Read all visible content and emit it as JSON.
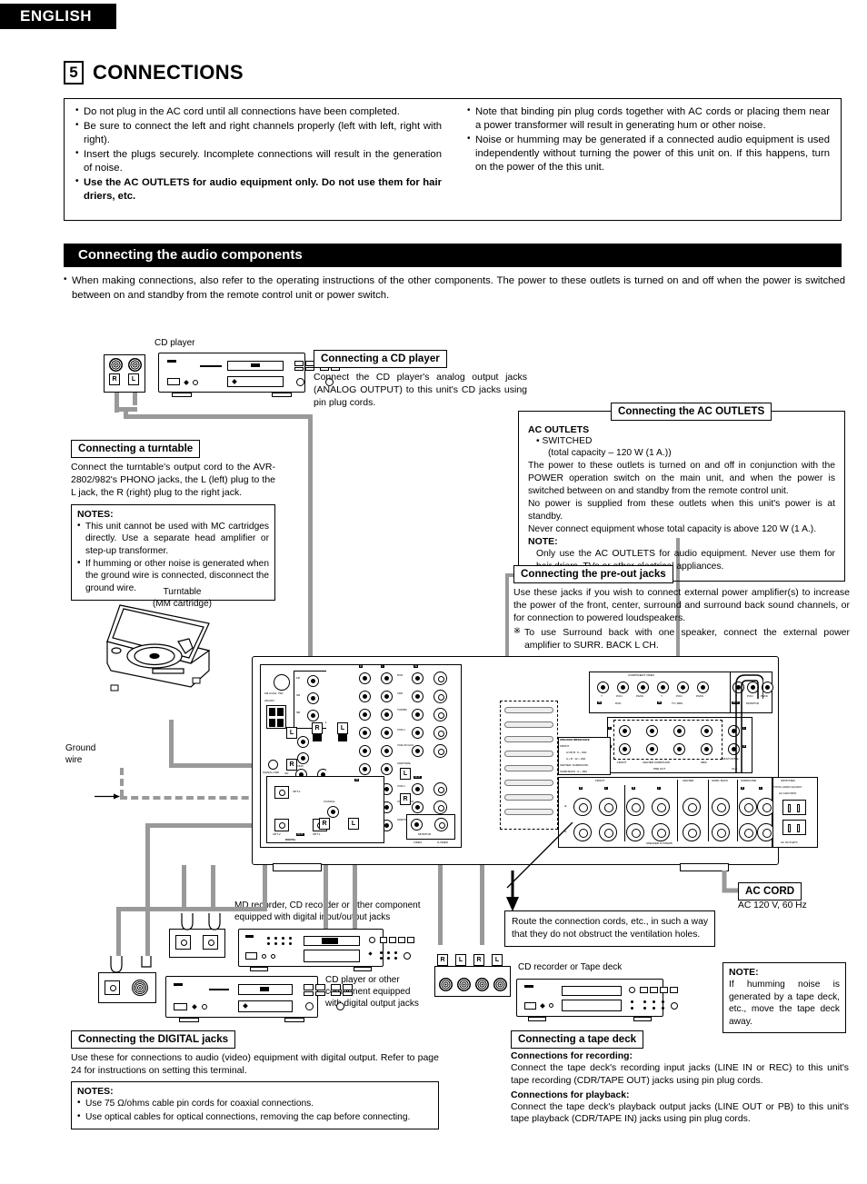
{
  "header": {
    "language": "ENGLISH",
    "chapter_number": "5",
    "chapter_title": "CONNECTIONS"
  },
  "warnings": {
    "left": [
      "Do not plug in the AC cord until all connections have been completed.",
      "Be sure to connect the left and right channels properly (left with left, right with right).",
      "Insert the plugs securely. Incomplete connections will result in the generation of noise.",
      "Use the AC OUTLETS for audio equipment only. Do not use them for hair driers, etc."
    ],
    "right": [
      "Note that binding pin plug cords together with AC cords or placing them near a power transformer will result in generating hum or other noise.",
      "Noise or humming may be generated if a connected audio equipment is used independently without turning the power of this unit on. If this happens, turn on the power of the this unit."
    ]
  },
  "section": {
    "title": "Connecting the audio components",
    "intro": "When making connections, also refer to the operating instructions of the other components. The power to these outlets is turned on and off when the power is switched between on and standby from the remote control unit or power switch."
  },
  "callouts": {
    "cd_player": {
      "title": "Connecting a CD player",
      "body": "Connect the CD player's analog output jacks (ANALOG OUTPUT) to this unit's CD jacks using pin plug cords."
    },
    "turntable": {
      "title": "Connecting a turntable",
      "body": "Connect the turntable's output cord to the AVR-2802/982's PHONO jacks, the L (left) plug to the L jack, the R (right) plug to the right jack.",
      "notes_header": "NOTES:",
      "notes": [
        "This unit cannot be used with MC cartridges directly. Use a separate head amplifier or step-up transformer.",
        "If humming or other noise is generated when the ground wire is connected, disconnect the ground wire."
      ]
    },
    "ac_outlets": {
      "title": "Connecting the AC OUTLETS",
      "heading": "AC OUTLETS",
      "switched": "SWITCHED",
      "capacity": "(total capacity – 120 W (1 A.))",
      "p1": "The power to these outlets is turned on and off in conjunction with the POWER operation switch on the main unit, and when the power is switched between on and standby from the remote control unit.",
      "p2": "No power is supplied from these outlets when this unit's power is at standby.",
      "p3": "Never connect equipment whose total capacity is above 120 W (1 A.).",
      "note_header": "NOTE:",
      "note": "Only use the AC OUTLETS for audio equipment. Never use them for hair driers, TVs or other electrical appliances."
    },
    "pre_out": {
      "title": "Connecting the pre-out jacks",
      "body": "Use these jacks if you wish to connect external power amplifier(s) to increase the power of the front, center, surround and surround back sound channels, or for connection to powered loudspeakers.",
      "mark": "※",
      "note": "To use Surround back with one speaker, connect the external power amplifier to SURR. BACK L CH."
    },
    "digital": {
      "title": "Connecting the DIGITAL jacks",
      "body": "Use these for connections to audio (video) equipment with digital output. Refer to page 24 for instructions on setting this terminal.",
      "notes_header": "NOTES:",
      "notes": [
        "Use 75 Ω/ohms cable pin cords for coaxial connections.",
        "Use optical cables for optical connections, removing the cap before connecting."
      ]
    },
    "tape_deck": {
      "title": "Connecting a tape deck",
      "rec_header": "Connections for recording:",
      "rec_body": "Connect the tape deck's recording input jacks (LINE IN or REC) to this unit's tape recording (CDR/TAPE OUT) jacks using pin plug cords.",
      "play_header": "Connections for playback:",
      "play_body": "Connect the tape deck's playback output jacks (LINE OUT or PB) to this unit's tape playback (CDR/TAPE IN) jacks using pin plug cords."
    },
    "route": "Route the connection cords, etc., in such a way that they do not obstruct the ventilation holes.",
    "tape_note": {
      "header": "NOTE:",
      "body": "If humming noise is generated by a tape deck, etc., move the tape deck away."
    }
  },
  "labels": {
    "cd_player": "CD player",
    "turntable_l1": "Turntable",
    "turntable_l2": "(MM cartridge)",
    "ground_l1": "Ground",
    "ground_l2": "wire",
    "md_recorder": "MD recorder, CD recorder or other component equipped with digital input/output jacks",
    "cd_optical": "CD player or other component equipped with digital output jacks",
    "cd_recorder_tape": "CD recorder or Tape deck",
    "ac_cord_title": "AC CORD",
    "ac_cord_spec": "AC 120 V, 60 Hz"
  },
  "rear_panel": {
    "antenna": {
      "fm": "FM COAX. 75Ω",
      "am": "AM ANT."
    },
    "ext_in": {
      "label": "EXT. IN",
      "jacks": [
        "FR",
        "FL",
        "SR",
        "C",
        "SB",
        "S"
      ]
    },
    "phono": {
      "signal_gnd": "SIGNAL GND",
      "phono": "PHONO",
      "cd": "CD"
    },
    "input_rows": [
      "DVD",
      "VDP",
      "TV/DBS",
      "VCR-1",
      "VCR-2/V.AUX",
      "CDR/TAPE"
    ],
    "output_rows": [
      "VCR-1",
      "VCR-2/V.AUX",
      "CDR/TAPE",
      "MONITOR"
    ],
    "row_headers": {
      "r": "R",
      "l": "L",
      "in": "IN",
      "out": "OUT"
    },
    "digital": {
      "label": "DIGITAL",
      "opt1": "OPT-1",
      "opt2": "OPT-2",
      "coaxial": "COAXIAL",
      "in": "IN",
      "out": "OUT"
    },
    "video": {
      "video": "VIDEO",
      "svideo": "S-VIDEO"
    },
    "component_video": {
      "label": "COMPONENT VIDEO",
      "groups": [
        {
          "name": "DVD",
          "mode": "IN",
          "jacks": [
            "Y",
            "Pr/Cr",
            "Pb/Cb"
          ]
        },
        {
          "name": "TV / DBS",
          "mode": "IN",
          "jacks": [
            "Y",
            "Pr/Cr",
            "Pb/Cb"
          ]
        },
        {
          "name": "MONITOR",
          "mode": "OUT",
          "jacks": [
            "Y",
            "Pr/Cr",
            "Pb/Cb"
          ]
        }
      ]
    },
    "pre_out": {
      "label": "PRE OUT",
      "groups": [
        "FRONT",
        "CENTER SURROUND",
        "SB/S"
      ],
      "multi_zone": "MULTI ZONE",
      "out": "OUT",
      "rl": [
        "L",
        "R"
      ]
    },
    "speaker_impedance": {
      "title": "SPEAKER IMPEDANCE",
      "lines": [
        "FRONT",
        "A OR B : 6 ~ 16Ω",
        "A + B : 12 ~ 16Ω",
        "CENTER, SURROUND,",
        "SURR.BACK : 6 ~ 16Ω"
      ]
    },
    "speakers": {
      "label": "SPEAKER SYSTEMS",
      "groups": [
        "FRONT",
        "CENTER",
        "SURR. BACK",
        "SURROUND"
      ],
      "rl": [
        "R",
        "L"
      ],
      "polarity": [
        "⊕",
        "⊖"
      ]
    },
    "ac_outlets": {
      "label": "AC OUTLETS",
      "switched": "SWITCHED",
      "spec1": "TOTAL 120W (1A) MAX.",
      "spec2": "AC 120V  60Hz"
    }
  }
}
